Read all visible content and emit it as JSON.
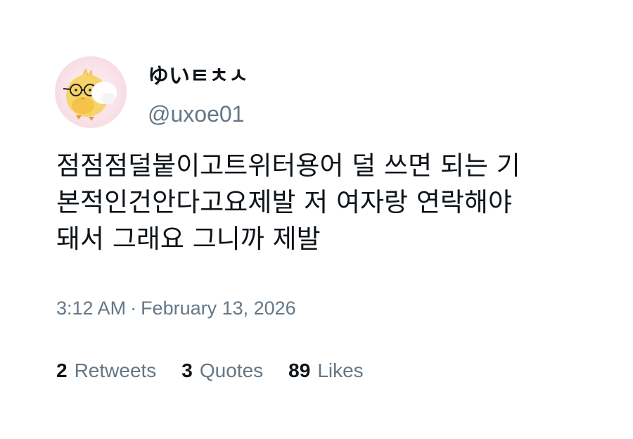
{
  "user": {
    "display_name": "ゆいㅌㅊㅅ",
    "handle": "@uxoe01"
  },
  "tweet": {
    "lines": [
      "점점점덜붙이고트위터용어 덜 쓰면 되는 기",
      "본적인건안다고요제발 저 여자랑 연락해야",
      "돼서 그래요 그니까 제발"
    ],
    "time": "3:12 AM",
    "separator": "·",
    "date": "February 13, 2026"
  },
  "stats": {
    "retweets": {
      "count": "2",
      "label": "Retweets"
    },
    "quotes": {
      "count": "3",
      "label": "Quotes"
    },
    "likes": {
      "count": "89",
      "label": "Likes"
    }
  },
  "colors": {
    "text_primary": "#0f1419",
    "text_secondary": "#657786",
    "avatar_bg": "#f8dde4"
  }
}
